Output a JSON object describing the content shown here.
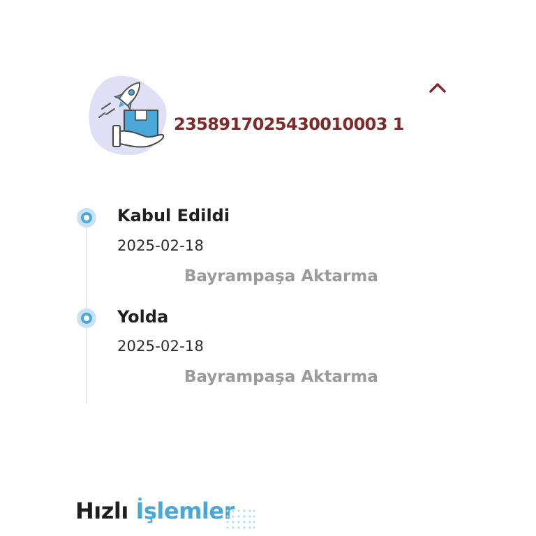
{
  "shipment": {
    "tracking_number": "2358917025430010003 1",
    "collapse_icon": "chevron-up-icon",
    "illustration_icon": "rocket-package-hand-icon",
    "accent_color": "#7e2a2a"
  },
  "timeline": {
    "events": [
      {
        "status": "Kabul Edildi",
        "date": "2025-02-18",
        "location": "Bayrampaşa Aktarma"
      },
      {
        "status": "Yolda",
        "date": "2025-02-18",
        "location": "Bayrampaşa Aktarma"
      }
    ],
    "dot_color": "#4aa8d9"
  },
  "quick_actions": {
    "title_part1": "Hızlı",
    "title_part2": "İşlemler",
    "title_accent_color": "#4aa8d9"
  }
}
